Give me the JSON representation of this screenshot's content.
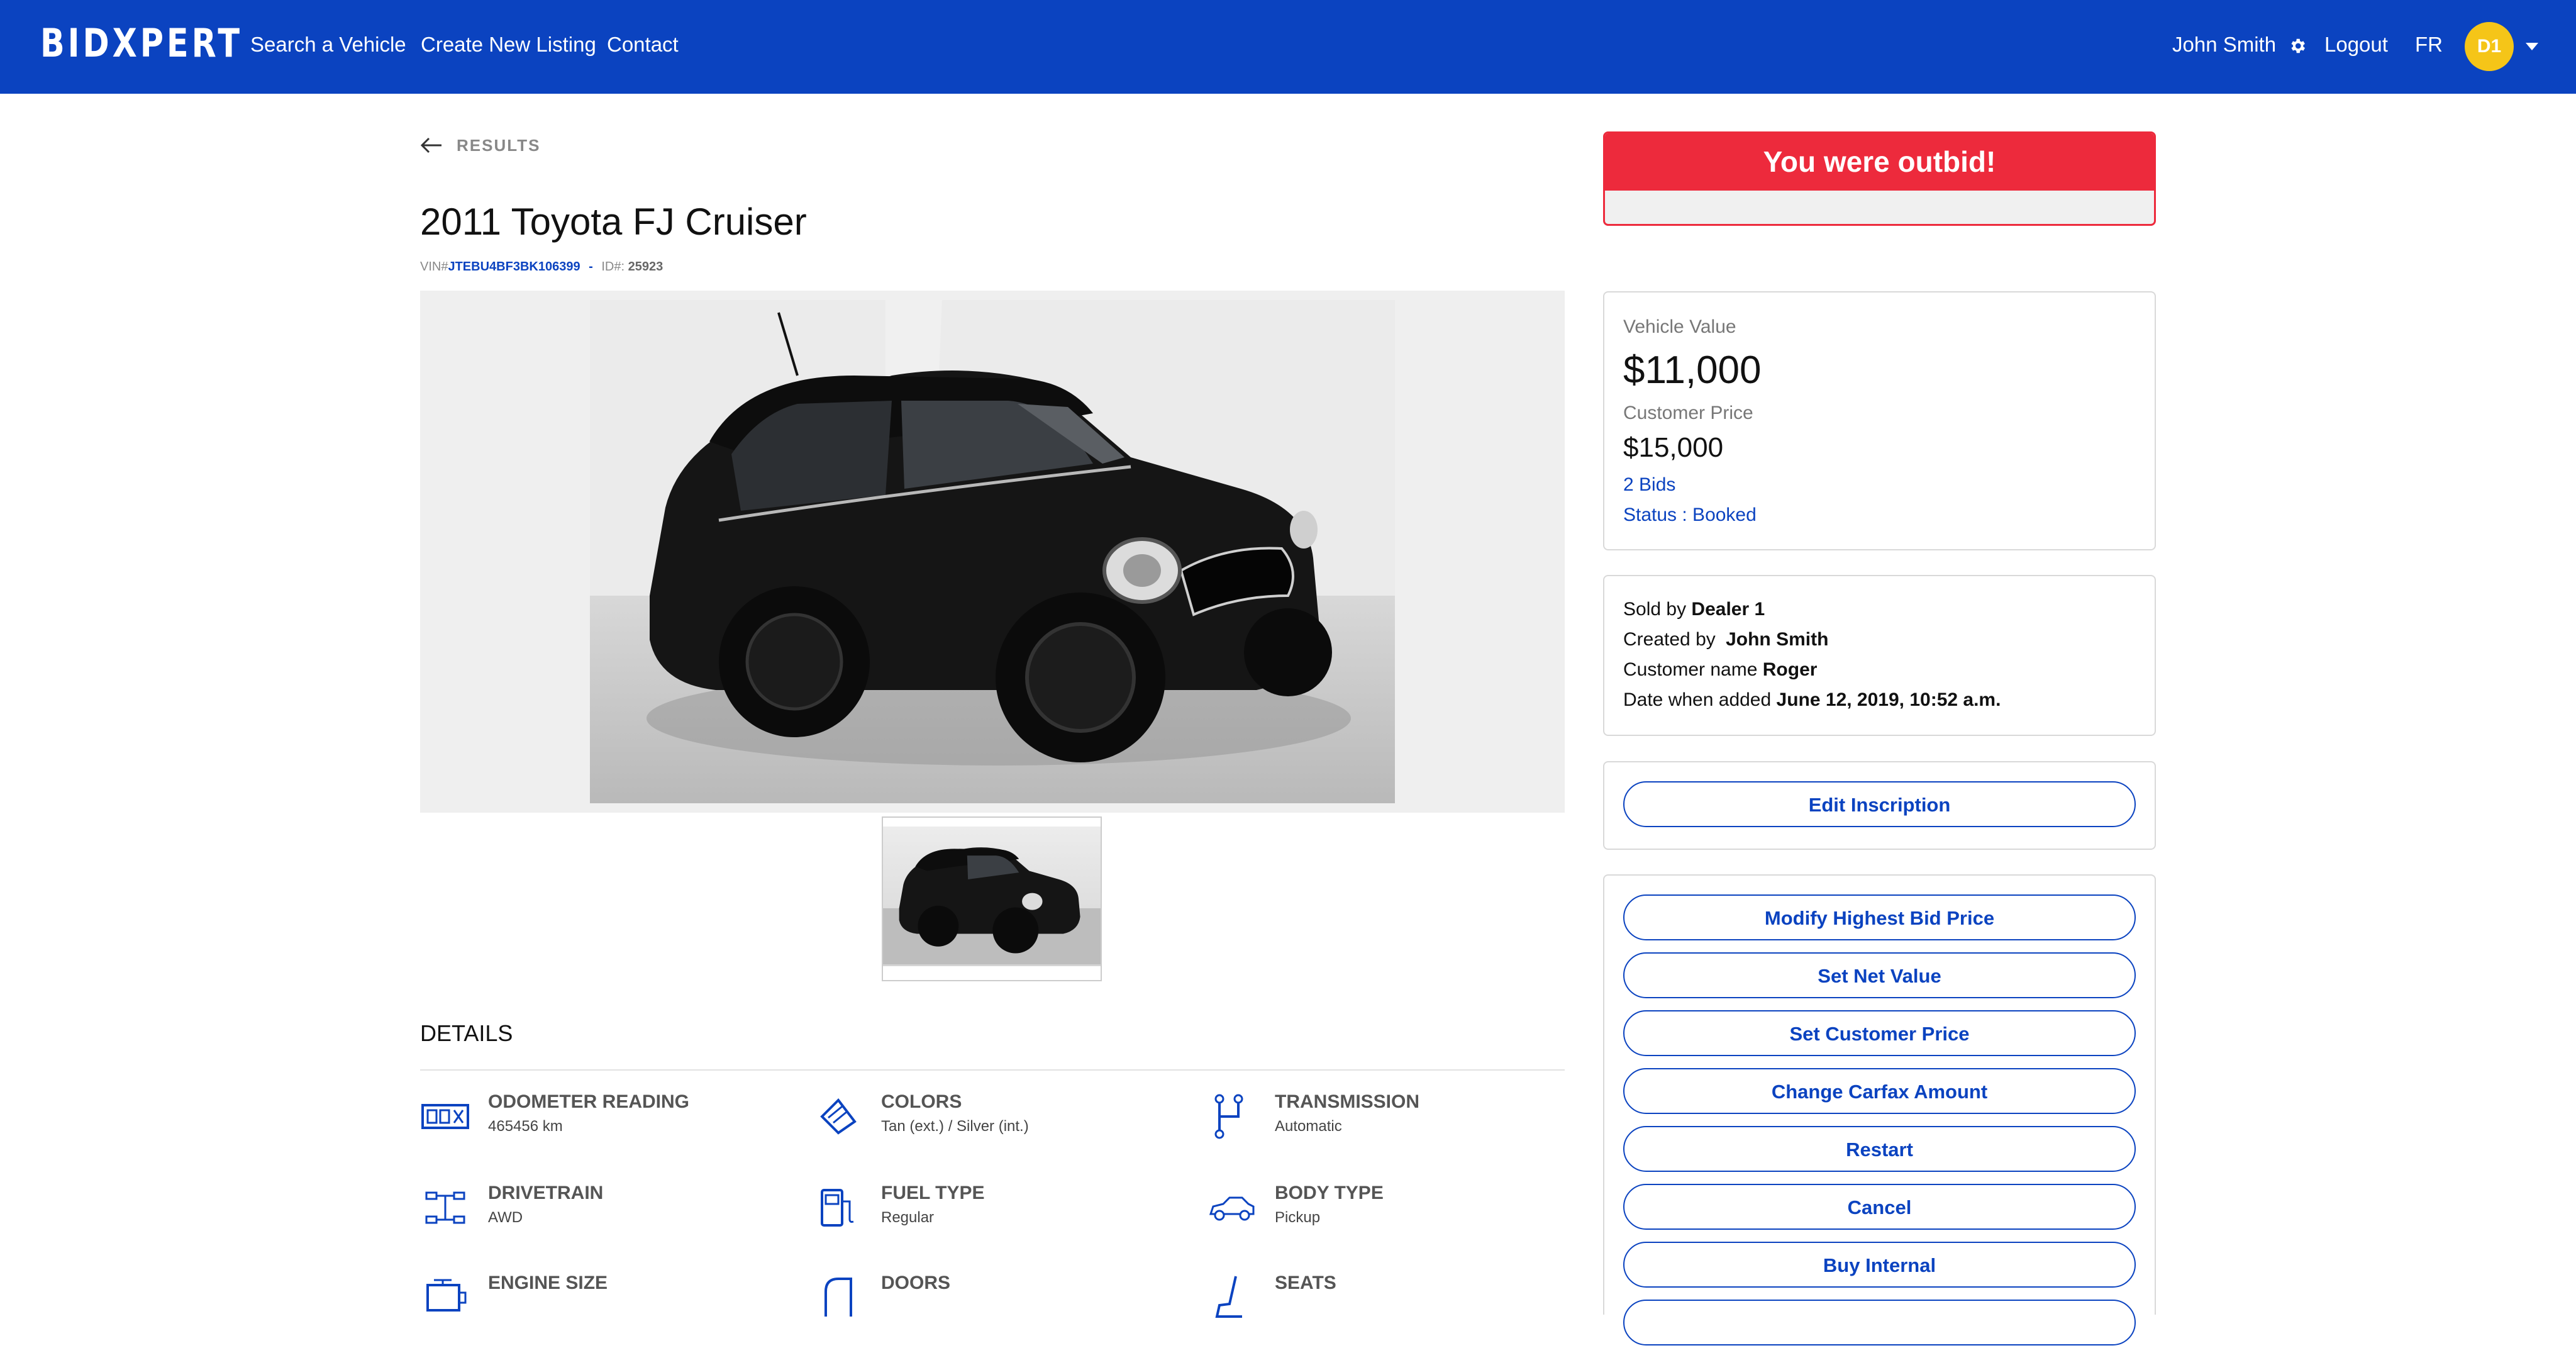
{
  "nav": {
    "brand": "BIDXPERT",
    "links": [
      "Search a Vehicle",
      "Create New Listing",
      "Contact"
    ],
    "user": "John Smith",
    "logout": "Logout",
    "lang": "FR",
    "avatar": "D1"
  },
  "back": {
    "label": "RESULTS"
  },
  "vehicle": {
    "title": "2011 Toyota FJ Cruiser",
    "vin_label": "VIN#",
    "vin": "JTEBU4BF3BK106399",
    "separator": "-",
    "id_label": "ID#:",
    "id": "25923"
  },
  "details": {
    "title": "DETAILS",
    "specs": [
      {
        "label": "ODOMETER READING",
        "value": "465456 km",
        "icon": "odometer-icon"
      },
      {
        "label": "COLORS",
        "value": "Tan (ext.) / Silver (int.)",
        "icon": "paint-icon"
      },
      {
        "label": "TRANSMISSION",
        "value": "Automatic",
        "icon": "gearbox-icon"
      },
      {
        "label": "DRIVETRAIN",
        "value": "AWD",
        "icon": "drivetrain-icon"
      },
      {
        "label": "FUEL TYPE",
        "value": "Regular",
        "icon": "fuel-pump-icon"
      },
      {
        "label": "BODY TYPE",
        "value": "Pickup",
        "icon": "car-icon"
      },
      {
        "label": "ENGINE SIZE",
        "value": "",
        "icon": "engine-icon"
      },
      {
        "label": "DOORS",
        "value": "",
        "icon": "door-icon"
      },
      {
        "label": "SEATS",
        "value": "",
        "icon": "seat-icon"
      }
    ]
  },
  "alert": {
    "text": "You were outbid!"
  },
  "pricing": {
    "vehicle_value_label": "Vehicle Value",
    "vehicle_value": "$11,000",
    "customer_price_label": "Customer Price",
    "customer_price": "$15,000",
    "bids": "2 Bids",
    "status": "Status : Booked"
  },
  "seller": {
    "sold_by_label": "Sold by",
    "sold_by": "Dealer 1",
    "created_by_label": "Created by",
    "created_by": "John Smith",
    "customer_label": "Customer name",
    "customer": "Roger",
    "date_label": "Date when added",
    "date": "June 12, 2019, 10:52 a.m."
  },
  "actions": {
    "edit": "Edit Inscription",
    "buttons": [
      "Modify Highest Bid Price",
      "Set Net Value",
      "Set Customer Price",
      "Change Carfax Amount",
      "Restart",
      "Cancel",
      "Buy Internal"
    ]
  },
  "colors": {
    "brand_blue": "#0b43c0",
    "alert_red": "#ed2a3c",
    "avatar_yellow": "#f5c518"
  }
}
